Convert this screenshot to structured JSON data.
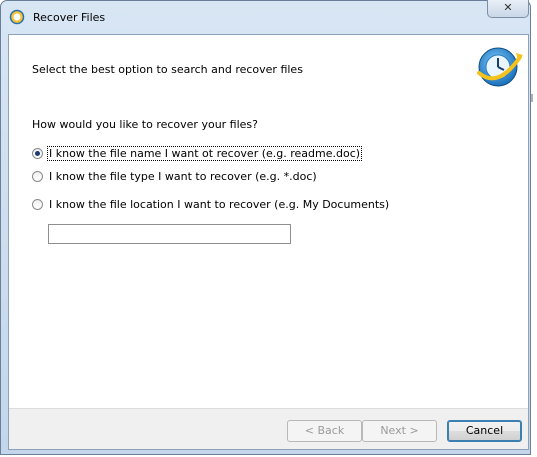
{
  "window": {
    "title": "Recover Files",
    "close_glyph": "✕",
    "title_icon": "recover-files-icon"
  },
  "header": {
    "subtitle": "Select the best option to search and recover files",
    "logo_icon": "recovery-clock-logo-icon"
  },
  "main": {
    "question": "How would you like to recover your files?",
    "options": [
      {
        "label": "I know the file name I want ot recover (e.g. readme.doc)",
        "checked": true
      },
      {
        "label": "I know the file type I want to recover (e.g. *.doc)",
        "checked": false
      },
      {
        "label": "I know the file location I want to recover (e.g. My Documents)",
        "checked": false
      }
    ],
    "input": {
      "value": "",
      "placeholder": ""
    }
  },
  "footer": {
    "back_label": "< Back",
    "next_label": "Next >",
    "cancel_label": "Cancel"
  },
  "colors": {
    "titlebar": "#c3d6eb",
    "accent": "#3c7fb1",
    "disabled_text": "#9a9a9a"
  }
}
